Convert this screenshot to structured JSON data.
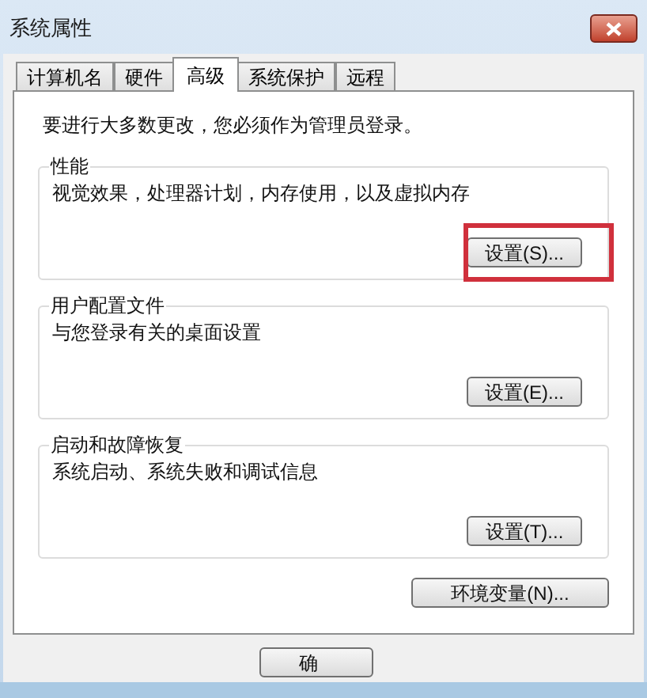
{
  "window": {
    "title": "系统属性"
  },
  "tabs": [
    {
      "label": "计算机名",
      "selected": false
    },
    {
      "label": "硬件",
      "selected": false
    },
    {
      "label": "高级",
      "selected": true
    },
    {
      "label": "系统保护",
      "selected": false
    },
    {
      "label": "远程",
      "selected": false
    }
  ],
  "notice": "要进行大多数更改，您必须作为管理员登录。",
  "groups": [
    {
      "title": "性能",
      "description": "视觉效果，处理器计划，内存使用，以及虚拟内存",
      "button": "设置(S)...",
      "highlighted": true
    },
    {
      "title": "用户配置文件",
      "description": "与您登录有关的桌面设置",
      "button": "设置(E)...",
      "highlighted": false
    },
    {
      "title": "启动和故障恢复",
      "description": "系统启动、系统失败和调试信息",
      "button": "设置(T)...",
      "highlighted": false
    }
  ],
  "env_button": "环境变量(N)...",
  "bottom_buttons": [
    "确"
  ]
}
